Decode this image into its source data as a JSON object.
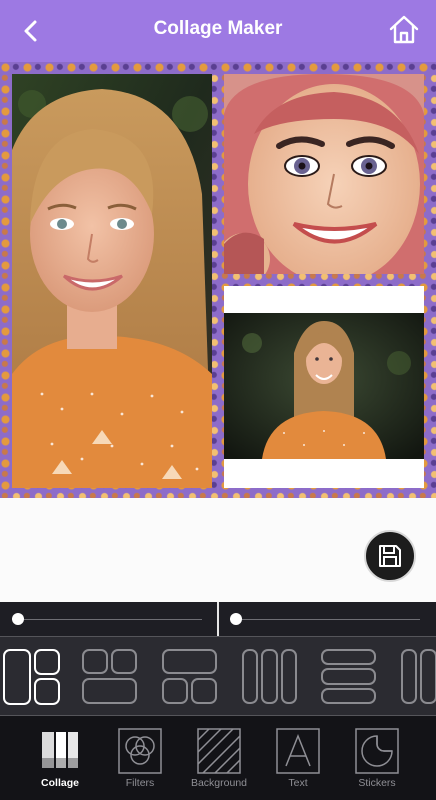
{
  "header": {
    "title": "Collage Maker",
    "back_icon": "back-arrow-icon",
    "home_icon": "home-icon",
    "bg": "#9d79e3"
  },
  "collage": {
    "background_pattern": "purple fox pattern",
    "photos": [
      "portrait-large",
      "cartoon-portrait",
      "portrait-small"
    ]
  },
  "fab": {
    "icon": "floppy-disk-icon"
  },
  "sliders": {
    "left_value": 0,
    "right_value": 0
  },
  "layouts": [
    {
      "name": "layout-1-big-2-small",
      "selected": true
    },
    {
      "name": "layout-2-top-1-bottom",
      "selected": false
    },
    {
      "name": "layout-1-top-2-bottom",
      "selected": false
    },
    {
      "name": "layout-3-columns",
      "selected": false
    },
    {
      "name": "layout-3-rows",
      "selected": false
    },
    {
      "name": "layout-partial",
      "selected": false
    }
  ],
  "toolbar": {
    "items": [
      {
        "label": "Collage",
        "icon": "collage-icon",
        "active": true
      },
      {
        "label": "Filters",
        "icon": "filters-icon",
        "active": false
      },
      {
        "label": "Background",
        "icon": "background-icon",
        "active": false
      },
      {
        "label": "Text",
        "icon": "text-icon",
        "active": false
      },
      {
        "label": "Stickers",
        "icon": "stickers-icon",
        "active": false
      }
    ]
  }
}
